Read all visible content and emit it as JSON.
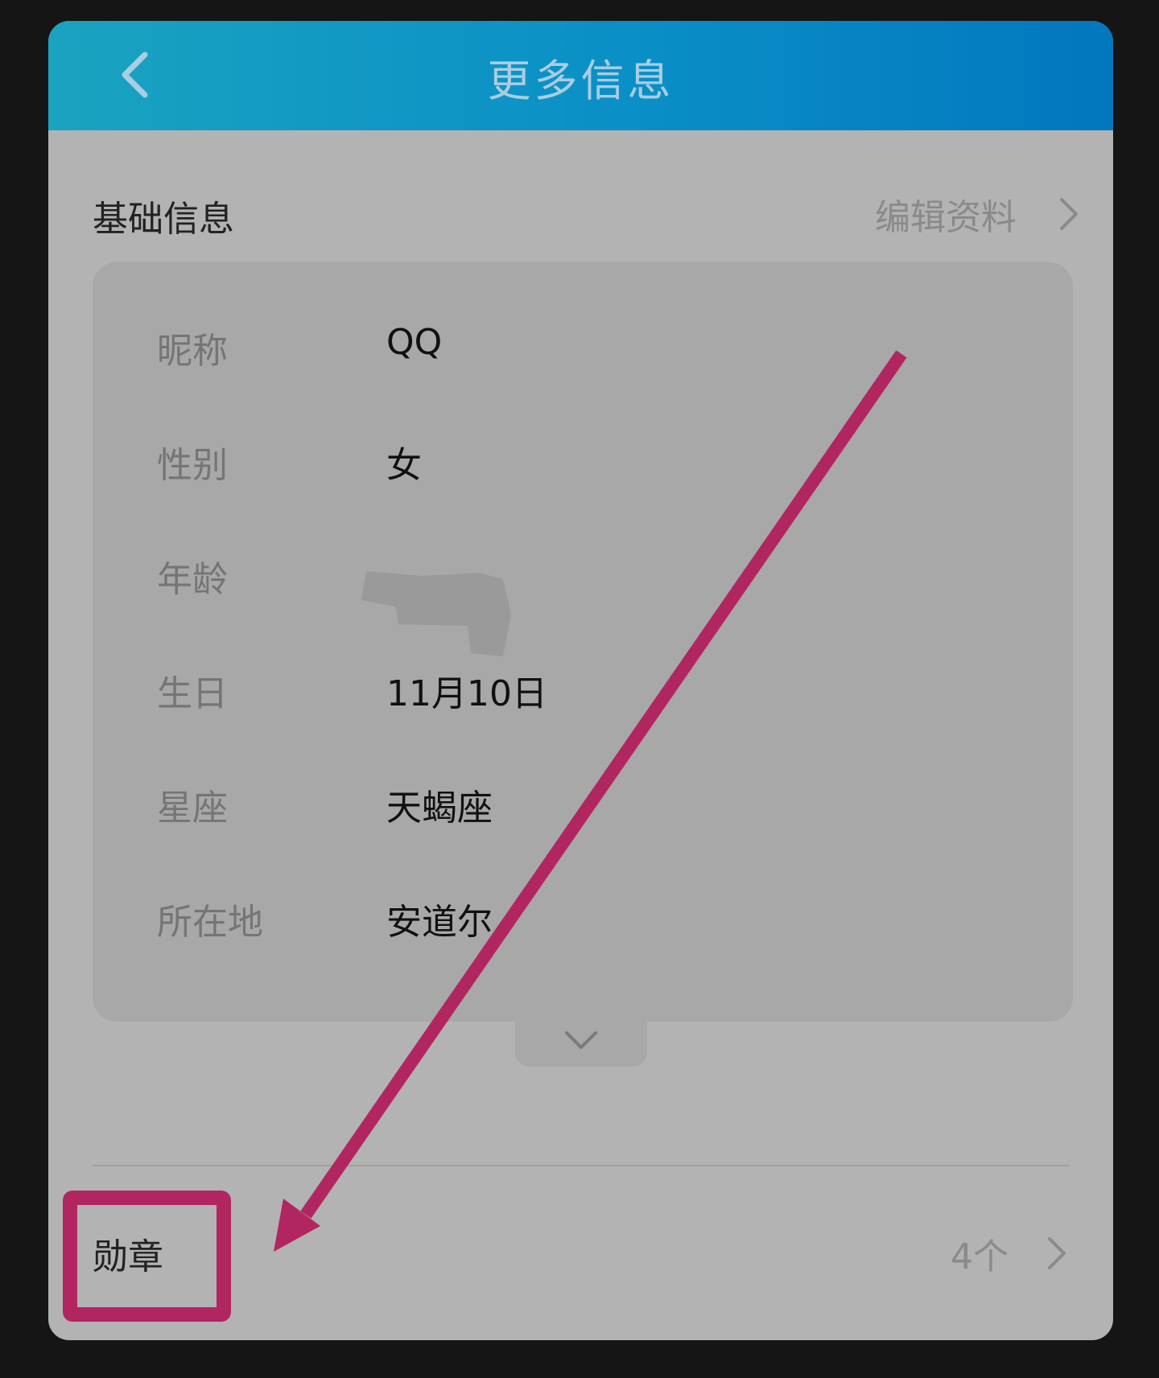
{
  "header": {
    "title": "更多信息"
  },
  "basic_info": {
    "section_title": "基础信息",
    "edit_label": "编辑资料",
    "rows": [
      {
        "label": "昵称",
        "value": "QQ"
      },
      {
        "label": "性别",
        "value": "女"
      },
      {
        "label": "年龄",
        "value": ""
      },
      {
        "label": "生日",
        "value": "11月10日"
      },
      {
        "label": "星座",
        "value": "天蝎座"
      },
      {
        "label": "所在地",
        "value": "安道尔"
      }
    ]
  },
  "badges": {
    "label": "勋章",
    "count": "4个"
  },
  "colors": {
    "header_gradient_start": "#1aa3c0",
    "header_gradient_end": "#0277be",
    "annotation": "#b12660"
  }
}
